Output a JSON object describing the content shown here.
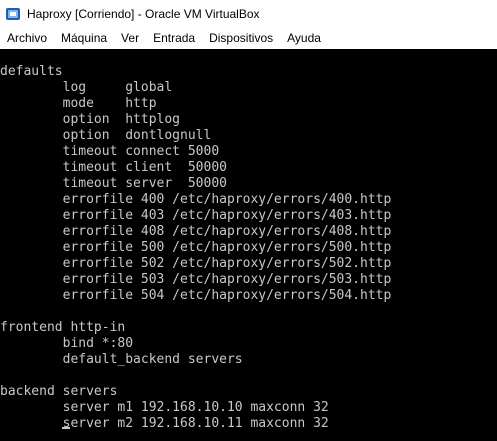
{
  "window": {
    "title": "Haproxy [Corriendo] - Oracle VM VirtualBox",
    "icon": "virtualbox-icon"
  },
  "menu": [
    "Archivo",
    "Máquina",
    "Ver",
    "Entrada",
    "Dispositivos",
    "Ayuda"
  ],
  "console": {
    "lines": [
      "defaults",
      "        log     global",
      "        mode    http",
      "        option  httplog",
      "        option  dontlognull",
      "        timeout connect 5000",
      "        timeout client  50000",
      "        timeout server  50000",
      "        errorfile 400 /etc/haproxy/errors/400.http",
      "        errorfile 403 /etc/haproxy/errors/403.http",
      "        errorfile 408 /etc/haproxy/errors/408.http",
      "        errorfile 500 /etc/haproxy/errors/500.http",
      "        errorfile 502 /etc/haproxy/errors/502.http",
      "        errorfile 503 /etc/haproxy/errors/503.http",
      "        errorfile 504 /etc/haproxy/errors/504.http",
      "",
      "frontend http-in",
      "        bind *:80",
      "        default_backend servers",
      "",
      "backend servers",
      "        server m1 192.168.10.10 maxconn 32",
      "        server m2 192.168.10.11 maxconn 32"
    ],
    "colors": {
      "text": "#c8c8c8",
      "background": "#000000"
    }
  }
}
